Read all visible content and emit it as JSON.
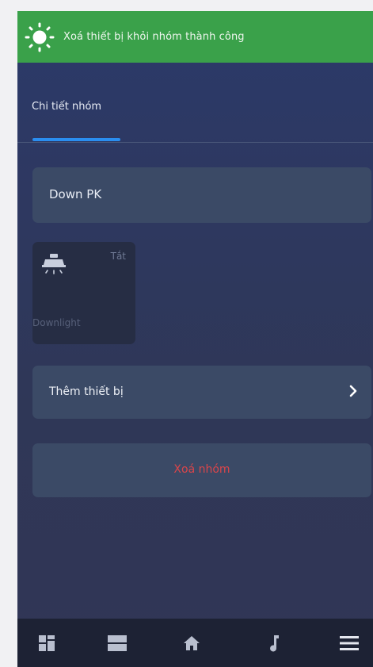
{
  "toast": {
    "message": "Xoá thiết bị khỏi nhóm thành công",
    "icon": "sun-icon",
    "color": "#3aa14a"
  },
  "tabs": [
    {
      "label": "Chi tiết nhóm",
      "active": true
    }
  ],
  "group": {
    "name": "Down PK"
  },
  "devices": [
    {
      "name": "Downlight",
      "status": "Tắt",
      "icon": "downlight-icon"
    }
  ],
  "actions": {
    "add_device": "Thêm thiết bị",
    "delete_group": "Xoá nhóm"
  },
  "bottom_nav": [
    {
      "icon": "dashboard-icon"
    },
    {
      "icon": "rooms-icon"
    },
    {
      "icon": "home-icon"
    },
    {
      "icon": "music-icon"
    },
    {
      "icon": "menu-icon"
    }
  ],
  "colors": {
    "accent": "#2a8ef0",
    "danger": "#d9454a",
    "card": "#3b4a66"
  }
}
